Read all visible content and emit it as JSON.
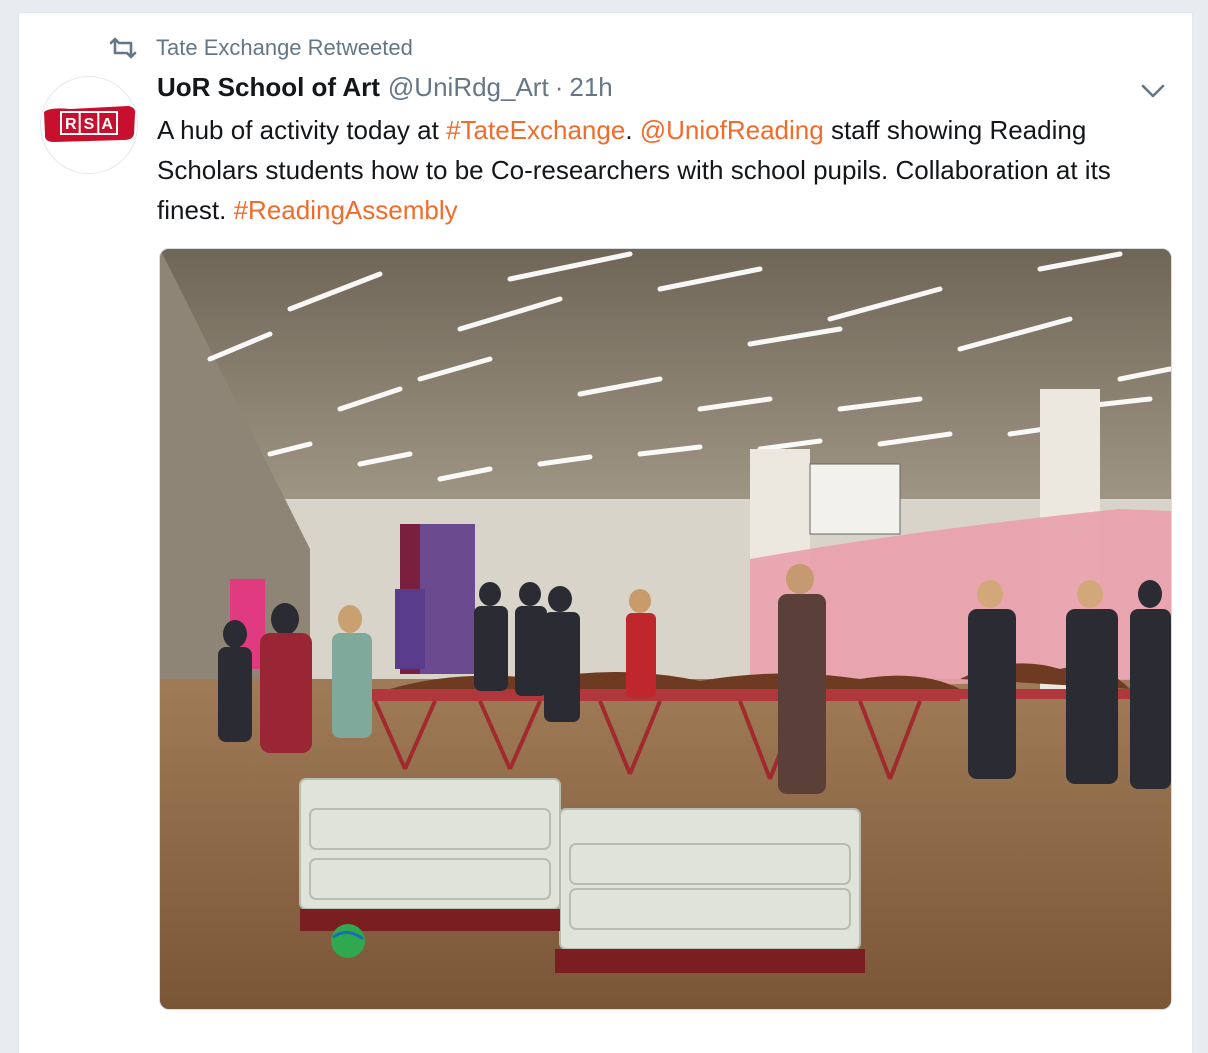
{
  "retweet": {
    "label": "Tate Exchange Retweeted",
    "icon": "retweet-icon"
  },
  "author": {
    "name": "UoR School of Art",
    "handle": "@UniRdg_Art",
    "separator": "·",
    "time": "21h",
    "avatar_text": "RSA"
  },
  "tweet": {
    "t1": "A hub of activity today at ",
    "tag1": "#TateExchange",
    "t2": ". ",
    "mention1": "@UniofReading",
    "t3": " staff showing Reading Scholars students how to be Co-researchers with school pupils. Collaboration at its finest. ",
    "tag2": "#ReadingAssembly"
  },
  "colors": {
    "accent": "#f26b2a",
    "secondary_text": "#657786",
    "primary_text": "#14171a",
    "background": "#e6ecf0",
    "avatar_red": "#c8102e"
  },
  "caret_icon": "chevron-down-icon"
}
